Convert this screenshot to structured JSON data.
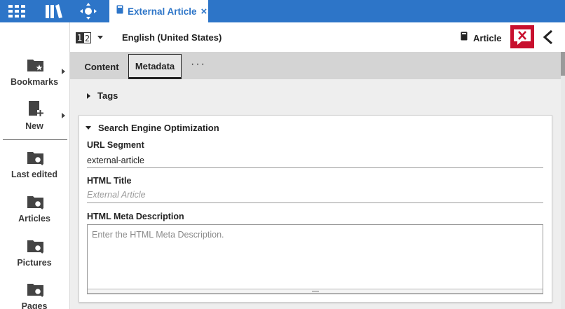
{
  "topbar": {
    "icons": [
      "apps-grid-icon",
      "library-icon",
      "move-arrows-icon"
    ],
    "tab": {
      "icon": "article-icon",
      "title": "External Article",
      "close": "×"
    }
  },
  "sidebar": {
    "items": [
      {
        "label": "Bookmarks",
        "icon": "bookmarks-folder-icon",
        "has_submenu": true
      },
      {
        "label": "New",
        "icon": "new-document-icon",
        "has_submenu": true
      },
      {
        "label": "Last edited",
        "icon": "search-folder-icon"
      },
      {
        "label": "Articles",
        "icon": "search-folder-icon"
      },
      {
        "label": "Pictures",
        "icon": "search-folder-icon"
      },
      {
        "label": "Pages",
        "icon": "search-folder-icon"
      }
    ]
  },
  "header": {
    "lang_icon_left": "1",
    "lang_icon_right": "2",
    "language": "English (United States)",
    "type_label": "Article",
    "close_icon": "close-x-icon",
    "collapse_icon": "chevron-left-icon"
  },
  "tabs": {
    "items": [
      {
        "label": "Content",
        "active": false
      },
      {
        "label": "Metadata",
        "active": true
      }
    ],
    "more": "···"
  },
  "content": {
    "tags_label": "Tags",
    "seo": {
      "title": "Search Engine Optimization",
      "url_segment_label": "URL Segment",
      "url_segment_value": "external-article",
      "html_title_label": "HTML Title",
      "html_title_placeholder": "External Article",
      "meta_description_label": "HTML Meta Description",
      "meta_description_placeholder": "Enter the HTML Meta Description."
    }
  },
  "colors": {
    "topbar": "#2d75c8",
    "close_button": "#c8102e",
    "tabs_bg": "#d4d4d4",
    "content_bg": "#eeeeee"
  }
}
